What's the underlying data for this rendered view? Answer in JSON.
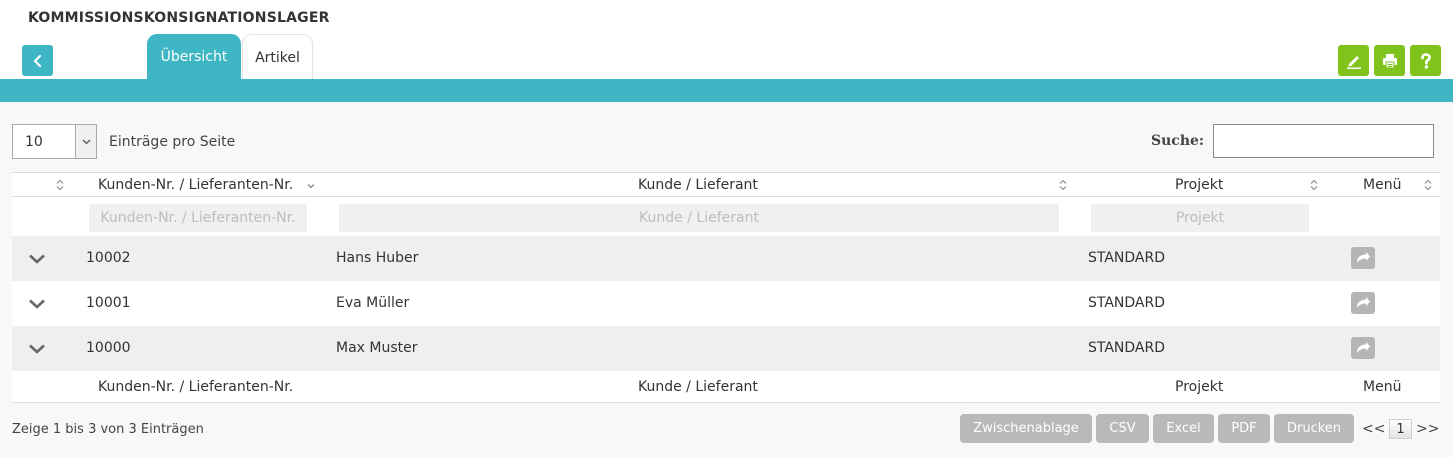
{
  "page": {
    "title": "KOMMISSIONSKONSIGNATIONSLAGER"
  },
  "tabs": [
    {
      "label": "Übersicht"
    },
    {
      "label": "Artikel"
    }
  ],
  "length": {
    "value": "10",
    "label": "Einträge pro Seite"
  },
  "search": {
    "label": "Suche:",
    "value": ""
  },
  "columns": {
    "customer_no": "Kunden-Nr. / Lieferanten-Nr.",
    "customer": "Kunde / Lieferant",
    "project": "Projekt",
    "menu": "Menü"
  },
  "filters": {
    "customer_no_placeholder": "Kunden-Nr. / Lieferanten-Nr.",
    "customer_placeholder": "Kunde / Lieferant",
    "project_placeholder": "Projekt"
  },
  "rows": [
    {
      "customer_no": "10002",
      "customer": "Hans Huber",
      "project": "STANDARD"
    },
    {
      "customer_no": "10001",
      "customer": "Eva Müller",
      "project": "STANDARD"
    },
    {
      "customer_no": "10000",
      "customer": "Max Muster",
      "project": "STANDARD"
    }
  ],
  "info": "Zeige 1 bis 3 von 3 Einträgen",
  "export_buttons": [
    "Zwischenablage",
    "CSV",
    "Excel",
    "PDF",
    "Drucken"
  ],
  "pager": {
    "prev": "<<",
    "current": "1",
    "next": ">>"
  },
  "colors": {
    "teal": "#3fb6c3",
    "green": "#7fc31c",
    "grey_button": "#b9b9b9"
  },
  "icons": {
    "back": "chevron-left-icon",
    "edit": "pencil-icon",
    "print": "printer-icon",
    "help": "question-icon",
    "row_expand": "chevron-down-icon",
    "row_menu": "arrow-redo-icon",
    "sort": "sort-icon"
  }
}
